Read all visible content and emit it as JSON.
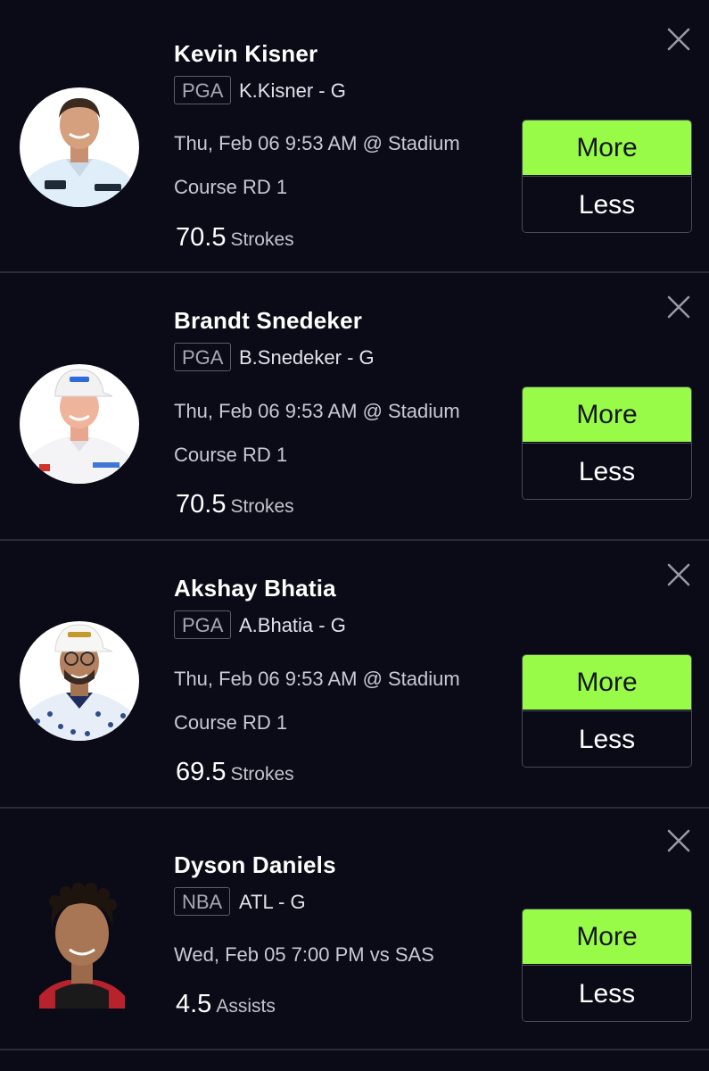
{
  "colors": {
    "background": "#0b0b18",
    "more_button": "#98fb48",
    "divider": "#2c2c38"
  },
  "picks": [
    {
      "name": "Kevin Kisner",
      "league": "PGA",
      "team": "K.Kisner - G",
      "datetime": "Thu, Feb 06 9:53 AM @ Stadium",
      "course": "Course RD 1",
      "line": "70.5",
      "stat": "Strokes",
      "more_label": "More",
      "less_label": "Less",
      "avatar_icon": "golfer-headshot"
    },
    {
      "name": "Brandt Snedeker",
      "league": "PGA",
      "team": "B.Snedeker - G",
      "datetime": "Thu, Feb 06 9:53 AM @ Stadium",
      "course": "Course RD 1",
      "line": "70.5",
      "stat": "Strokes",
      "more_label": "More",
      "less_label": "Less",
      "avatar_icon": "golfer-headshot"
    },
    {
      "name": "Akshay Bhatia",
      "league": "PGA",
      "team": "A.Bhatia - G",
      "datetime": "Thu, Feb 06 9:53 AM @ Stadium",
      "course": "Course RD 1",
      "line": "69.5",
      "stat": "Strokes",
      "more_label": "More",
      "less_label": "Less",
      "avatar_icon": "golfer-headshot"
    },
    {
      "name": "Dyson Daniels",
      "league": "NBA",
      "team": "ATL - G",
      "datetime": "Wed, Feb 05 7:00 PM vs SAS",
      "line": "4.5",
      "stat": "Assists",
      "more_label": "More",
      "less_label": "Less",
      "avatar_icon": "player-headshot"
    }
  ]
}
